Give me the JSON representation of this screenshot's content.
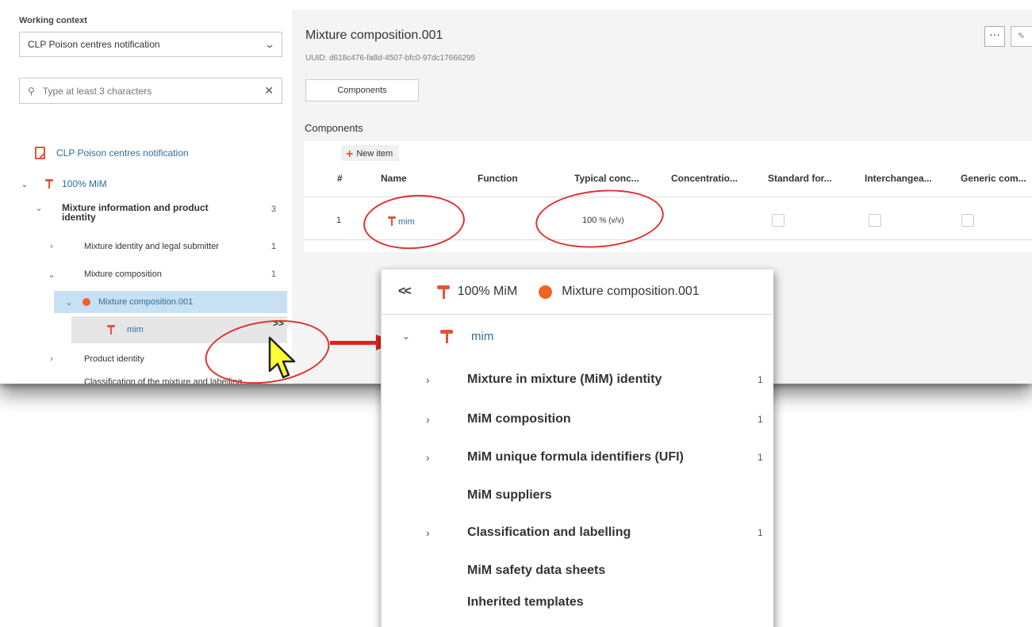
{
  "sidebar": {
    "working_context_label": "Working context",
    "context_value": "CLP Poison centres notification",
    "search_placeholder": "Type at least 3 characters",
    "tree": {
      "root_label": "CLP Poison centres notification",
      "mixture_label": "100% MiM",
      "section_label": "Mixture information and product identity",
      "section_count": "3",
      "identity_label": "Mixture identity and legal submitter",
      "identity_count": "1",
      "composition_label": "Mixture composition",
      "composition_count": "1",
      "selected_label": "Mixture composition.001",
      "mim_label": "mim",
      "expand_label": ">>",
      "product_label": "Product identity",
      "classification_partial": "Classification of the mixture and labelling"
    }
  },
  "main": {
    "title": "Mixture composition.001",
    "uuid": "UUID: d618c476-fa8d-4507-bfc0-97dc17666295",
    "more_label": "···",
    "tab_label": "Components",
    "section_title": "Components",
    "new_item_label": "New item",
    "columns": [
      "#",
      "Name",
      "Function",
      "Typical conc...",
      "Concentratio...",
      "Standard for...",
      "Interchangea...",
      "Generic com..."
    ],
    "row": {
      "index": "1",
      "name": "mim",
      "typical_conc_value": "100",
      "typical_conc_unit": "% (v/v)"
    }
  },
  "zoom": {
    "back_label": "<<",
    "crumb_mixture": "100% MiM",
    "crumb_composition": "Mixture composition.001",
    "mim_label": "mim",
    "items": [
      {
        "label": "Mixture in mixture (MiM) identity",
        "count": "1",
        "expandable": true
      },
      {
        "label": "MiM composition",
        "count": "1",
        "expandable": true
      },
      {
        "label": "MiM unique formula identifiers (UFI)",
        "count": "1",
        "expandable": true
      },
      {
        "label": "MiM suppliers",
        "count": "",
        "expandable": false
      },
      {
        "label": "Classification and labelling",
        "count": "1",
        "expandable": true
      },
      {
        "label": "MiM safety data sheets",
        "count": "",
        "expandable": false
      },
      {
        "label": "Inherited templates",
        "count": "",
        "expandable": false
      }
    ]
  },
  "colors": {
    "accent_orange": "#f26322",
    "icon_red": "#e05638",
    "highlight_red": "#e03030",
    "selected_row": "#c7e0f4",
    "link_blue": "#2f6d9e"
  }
}
